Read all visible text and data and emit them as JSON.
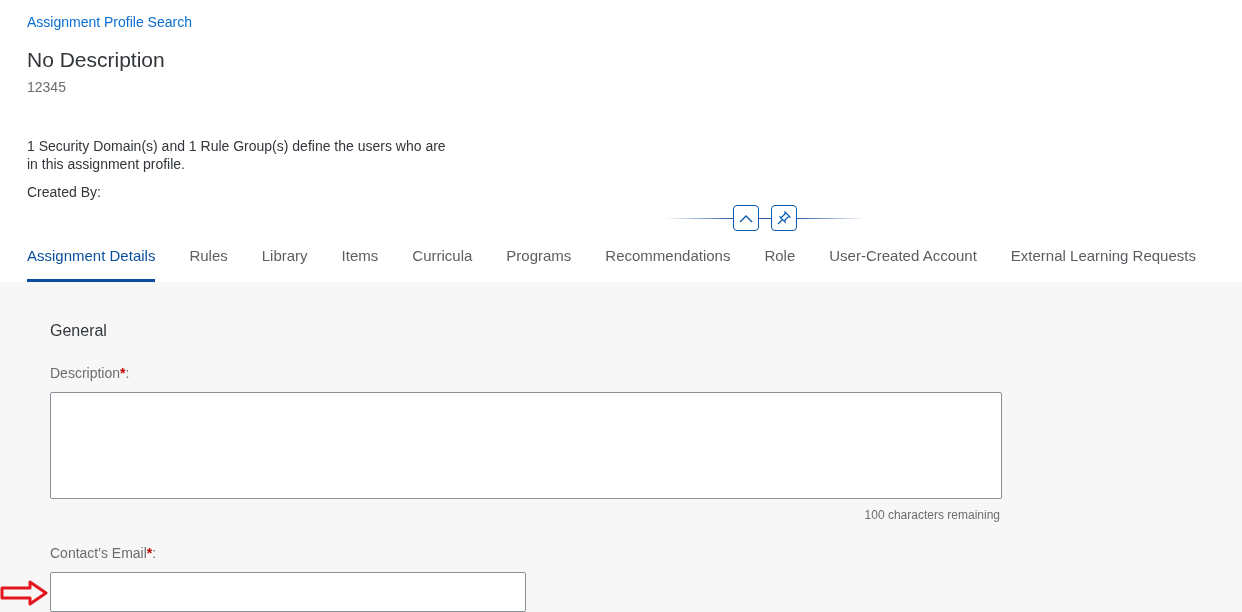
{
  "breadcrumb": "Assignment Profile Search",
  "header": {
    "title": "No Description",
    "subtitle": "12345",
    "summary": "1 Security Domain(s) and 1 Rule Group(s) define the users who are in this assignment profile.",
    "created_by": "Created By:"
  },
  "tabs": [
    {
      "label": "Assignment Details",
      "selected": true
    },
    {
      "label": "Rules",
      "selected": false
    },
    {
      "label": "Library",
      "selected": false
    },
    {
      "label": "Items",
      "selected": false
    },
    {
      "label": "Curricula",
      "selected": false
    },
    {
      "label": "Programs",
      "selected": false
    },
    {
      "label": "Recommendations",
      "selected": false
    },
    {
      "label": "Role",
      "selected": false
    },
    {
      "label": "User-Created Account",
      "selected": false
    },
    {
      "label": "External Learning Requests",
      "selected": false
    }
  ],
  "section": {
    "title": "General",
    "fields": [
      {
        "kind": "textarea",
        "label": "Description",
        "mark": "*",
        "colon": ":",
        "counter": "100 characters remaining"
      },
      {
        "kind": "input",
        "label": "Contact's Email",
        "mark": "*",
        "colon": ":"
      }
    ]
  }
}
